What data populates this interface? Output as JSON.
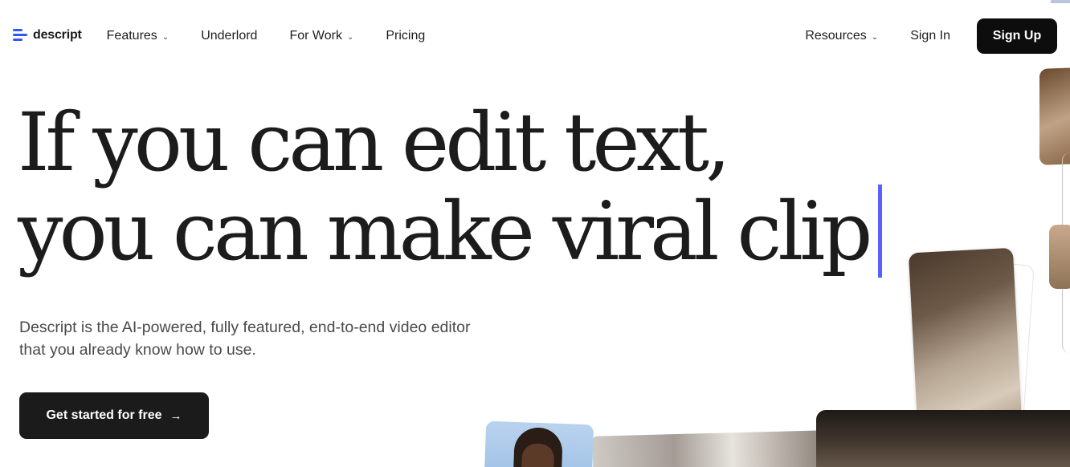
{
  "nav": {
    "brand": "descript",
    "items": [
      {
        "label": "Features",
        "has_dropdown": true
      },
      {
        "label": "Underlord",
        "has_dropdown": false
      },
      {
        "label": "For Work",
        "has_dropdown": true
      },
      {
        "label": "Pricing",
        "has_dropdown": false
      }
    ],
    "resources_label": "Resources",
    "sign_in_label": "Sign In",
    "sign_up_label": "Sign Up",
    "dropdown_glyph": "⌄"
  },
  "hero": {
    "headline_line1": "If you can edit text,",
    "headline_line2": "you can make viral clip",
    "subtext_line1": "Descript is the AI-powered, fully featured, end-to-end video editor",
    "subtext_line2": "that you already know how to use.",
    "cta_label": "Get started for free",
    "cta_arrow": "→"
  },
  "colors": {
    "brand_blue": "#2c59f5",
    "caret": "#5a5fff",
    "button_dark": "#0d0d0d"
  },
  "icons": {
    "logo": "descript-logo-icon",
    "dropdown": "chevron-down-icon",
    "cta_arrow": "arrow-right-icon"
  }
}
